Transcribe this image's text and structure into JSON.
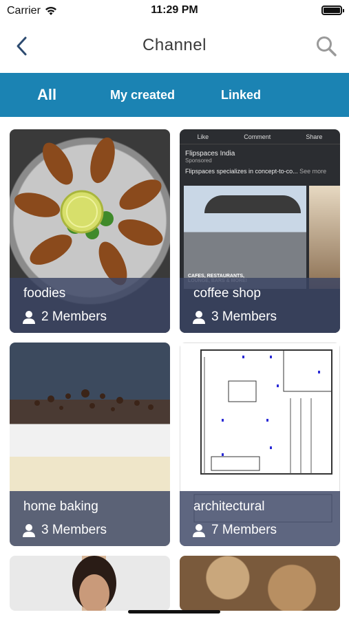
{
  "status_bar": {
    "carrier": "Carrier",
    "time": "11:29 PM"
  },
  "nav": {
    "title": "Channel"
  },
  "tabs": [
    {
      "label": "All",
      "active": true
    },
    {
      "label": "My created",
      "active": false
    },
    {
      "label": "Linked",
      "active": false
    }
  ],
  "colors": {
    "accent": "#1b83b3",
    "card_overlay": "#3a4464"
  },
  "channels": [
    {
      "name": "foodies",
      "members": "2 Members",
      "image": "fried-fish-with-lime"
    },
    {
      "name": "coffee shop",
      "members": "3 Members",
      "image": "flipspaces-cafe-ad"
    },
    {
      "name": "home baking",
      "members": "3 Members",
      "image": "tres-leches-cake"
    },
    {
      "name": "architectural",
      "members": "7 Members",
      "image": "floor-plan-drawing"
    },
    {
      "name": "",
      "members": "",
      "image": "woman-portrait"
    },
    {
      "name": "",
      "members": "",
      "image": "peanuts"
    }
  ],
  "cafe_ad": {
    "actions": [
      "Like",
      "Comment",
      "Share"
    ],
    "page": "Flipspaces India",
    "sponsored": "Sponsored",
    "text": "Flipspaces specializes in concept-to-co...",
    "see_more": "See more",
    "caption": "CAFES, RESTAURANTS, LOUNGE, BARS & MORE!"
  }
}
